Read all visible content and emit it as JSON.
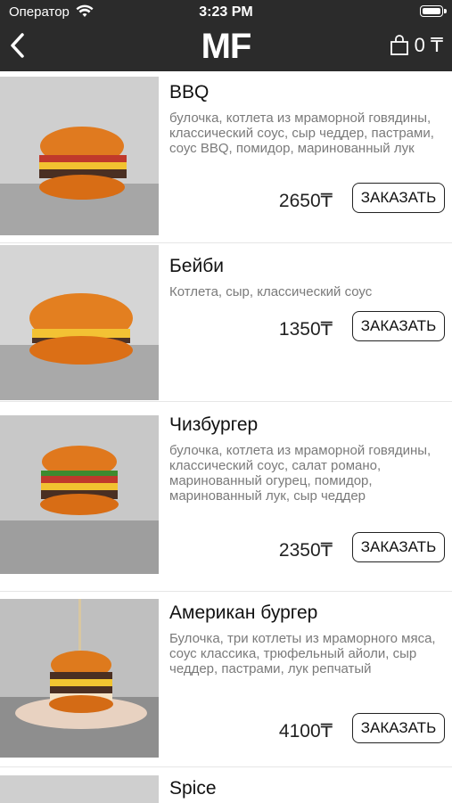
{
  "status": {
    "carrier": "Оператор",
    "time": "3:23 PM"
  },
  "header": {
    "logo": "MF",
    "cart_count": "0 ₸"
  },
  "items": [
    {
      "title": "BBQ",
      "desc": "булочка, котлета из мраморной говядины, классический соус, сыр чеддер, пастрами, соус BBQ, помидор, маринованный лук",
      "price": "2650₸",
      "button": "ЗАКАЗАТЬ"
    },
    {
      "title": "Бейби",
      "desc": "Котлета, сыр, классический соус",
      "price": "1350₸",
      "button": "ЗАКАЗАТЬ"
    },
    {
      "title": "Чизбургер",
      "desc": "булочка, котлета из мраморной говядины, классический соус, салат романо, маринованный огурец, помидор, маринованный лук, сыр чеддер",
      "price": "2350₸",
      "button": "ЗАКАЗАТЬ"
    },
    {
      "title": "Американ бургер",
      "desc": "Булочка, три котлеты из мраморного мяса, соус классика, трюфельный айоли, сыр чеддер, пастрами, лук репчатый",
      "price": "4100₸",
      "button": "ЗАКАЗАТЬ"
    },
    {
      "title": "Spice"
    }
  ]
}
